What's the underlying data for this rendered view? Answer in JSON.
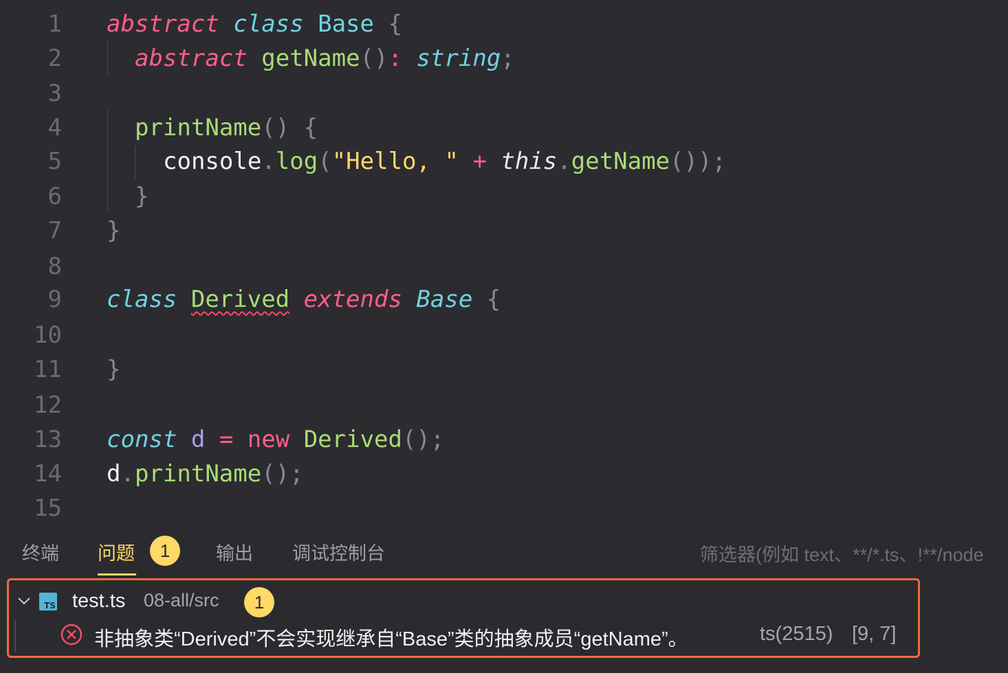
{
  "editor": {
    "line_numbers": [
      "1",
      "2",
      "3",
      "4",
      "5",
      "6",
      "7",
      "8",
      "9",
      "10",
      "11",
      "12",
      "13",
      "14",
      "15"
    ],
    "tokens": {
      "abstract": "abstract",
      "class": "class",
      "Base": "Base",
      "open_brace": "{",
      "close_brace": "}",
      "getName": "getName",
      "paren_pair": "()",
      "colon": ":",
      "string": "string",
      "semi": ";",
      "printName": "printName",
      "console": "console",
      "dot": ".",
      "log": "log",
      "open_paren": "(",
      "close_paren": ")",
      "hello_str": "\"Hello, \"",
      "plus": "+",
      "this": "this",
      "call_end": "());",
      "Derived": "Derived",
      "extends": "extends",
      "const": "const",
      "d": "d",
      "eq": "=",
      "new": "new",
      "paren_semi": "();"
    }
  },
  "panel": {
    "tabs": [
      {
        "label": "终端"
      },
      {
        "label": "问题",
        "badge": "1"
      },
      {
        "label": "输出"
      },
      {
        "label": "调试控制台"
      }
    ],
    "filter_placeholder": "筛选器(例如 text、**/*.ts、!**/node",
    "problems": {
      "file_name": "test.ts",
      "file_path": "08-all/src",
      "file_badge": "1",
      "ts_icon_label": "TS",
      "message": "非抽象类“Derived”不会实现继承自“Base”类的抽象成员“getName”。",
      "code": "ts(2515)",
      "position": "[9, 7]"
    }
  },
  "colors": {
    "keyword": "#ff5f87",
    "type": "#6fd3e0",
    "function": "#a9dc76",
    "string": "#ffd866",
    "accent": "#ffd866",
    "error_border": "#f26b3a",
    "error_icon": "#ff4a6a"
  }
}
